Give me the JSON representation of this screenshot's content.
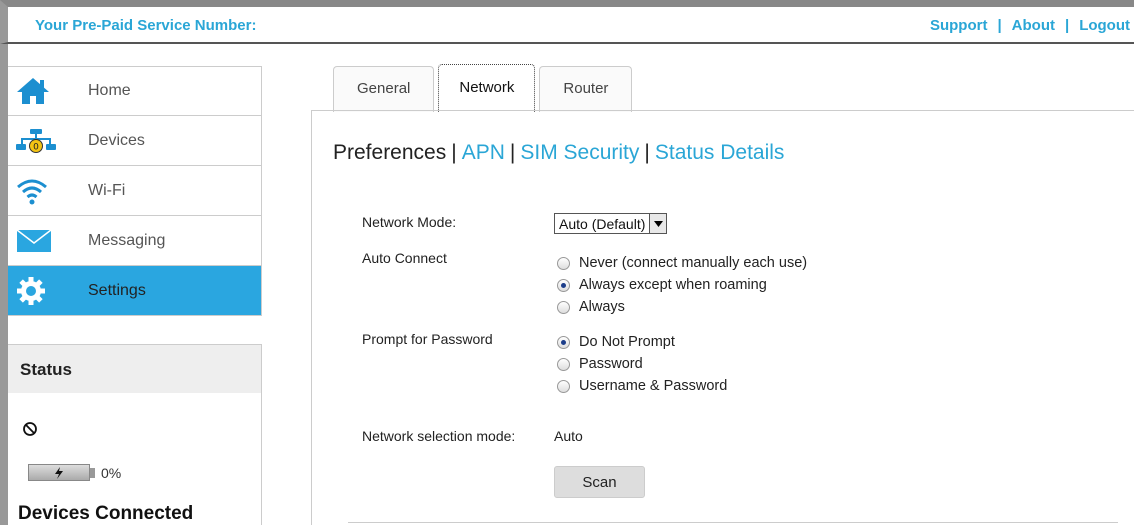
{
  "header": {
    "service_label": "Your Pre-Paid Service Number:",
    "links": [
      "Support",
      "About",
      "Logout"
    ]
  },
  "sidebar": {
    "items": [
      {
        "label": "Home",
        "icon": "home-icon"
      },
      {
        "label": "Devices",
        "icon": "devices-icon"
      },
      {
        "label": "Wi-Fi",
        "icon": "wifi-icon"
      },
      {
        "label": "Messaging",
        "icon": "envelope-icon"
      },
      {
        "label": "Settings",
        "icon": "gear-icon",
        "active": true
      }
    ]
  },
  "status": {
    "title": "Status",
    "battery_percent": "0%",
    "devices_connected_label": "Devices Connected"
  },
  "tabs": [
    "General",
    "Network",
    "Router"
  ],
  "active_tab": "Network",
  "subnav": {
    "current": "Preferences",
    "links": [
      "APN",
      "SIM Security",
      "Status Details"
    ]
  },
  "form": {
    "network_mode_label": "Network Mode:",
    "network_mode_value": "Auto (Default)",
    "auto_connect_label": "Auto Connect",
    "auto_connect_options": [
      "Never (connect manually each use)",
      "Always except when roaming",
      "Always"
    ],
    "auto_connect_selected": 1,
    "prompt_label": "Prompt for Password",
    "prompt_options": [
      "Do Not Prompt",
      "Password",
      "Username & Password"
    ],
    "prompt_selected": 0,
    "selection_mode_label": "Network selection mode:",
    "selection_mode_value": "Auto",
    "scan_label": "Scan"
  },
  "colors": {
    "accent": "#2aa6d6",
    "active_nav": "#2aa6e0"
  }
}
